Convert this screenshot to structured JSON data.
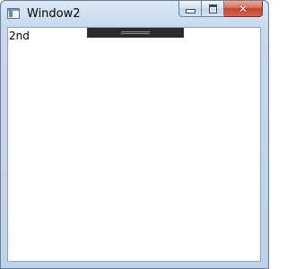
{
  "window": {
    "title": "Window2",
    "app_icon": "window-app-icon",
    "caption_buttons": {
      "minimize_icon": "minimize-icon",
      "maximize_icon": "maximize-icon",
      "close_icon": "close-icon",
      "close_glyph": "✕"
    }
  },
  "content": {
    "label": "2nd"
  },
  "colors": {
    "close_button": "#c2442c",
    "titlebar": "#c6d9ee",
    "drag_handle": "#2b2b2b"
  }
}
